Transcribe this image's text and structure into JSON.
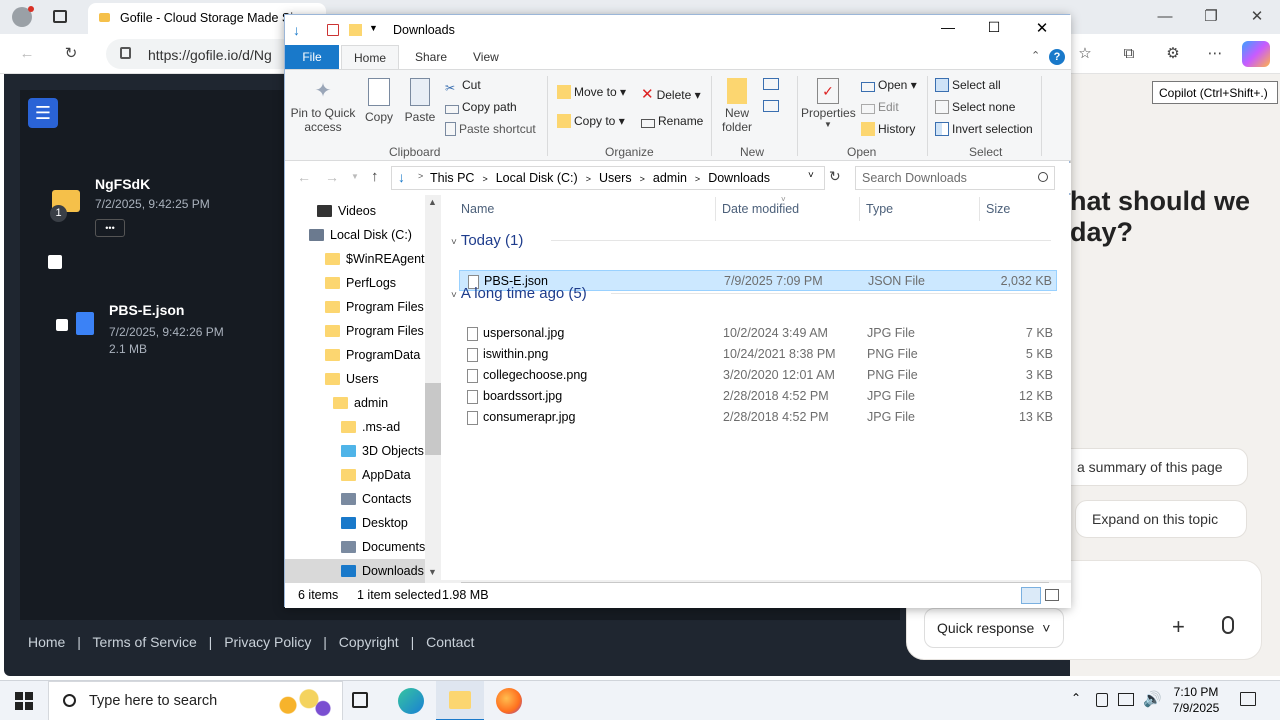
{
  "edge": {
    "tab_title": "Gofile - Cloud Storage Made Si",
    "address": "https://gofile.io/d/Ng",
    "tooltip": "Copilot (Ctrl+Shift+.)"
  },
  "gofile": {
    "folder_name": "NgFSdK",
    "folder_date": "7/2/2025, 9:42:25 PM",
    "folder_badge": "1",
    "more_label": "•••",
    "file_name": "PBS-E.json",
    "file_date": "7/2/2025, 9:42:26 PM",
    "file_size": "2.1 MB",
    "footer": [
      "Home",
      "Terms of Service",
      "Privacy Policy",
      "Copyright",
      "Contact"
    ]
  },
  "copilot": {
    "heading_line1": "hat should we",
    "heading_line2": "day?",
    "chip1": "a summary of this page",
    "chip2": "Expand on this topic",
    "quick": "Quick response"
  },
  "explorer": {
    "title": "Downloads",
    "tabs": [
      "File",
      "Home",
      "Share",
      "View"
    ],
    "clipboard": {
      "pin": [
        "Pin to Quick",
        "access"
      ],
      "copy": "Copy",
      "paste": "Paste",
      "cut": "Cut",
      "copy_path": "Copy path",
      "paste_shortcut": "Paste shortcut",
      "label": "Clipboard"
    },
    "organize": {
      "move_to": "Move to",
      "copy_to": "Copy to",
      "delete": "Delete",
      "rename": "Rename",
      "label": "Organize"
    },
    "new": {
      "new_folder": [
        "New",
        "folder"
      ],
      "label": "New"
    },
    "open": {
      "properties": "Properties",
      "open": "Open",
      "edit": "Edit",
      "history": "History",
      "label": "Open"
    },
    "select": {
      "select_all": "Select all",
      "select_none": "Select none",
      "invert": "Invert selection",
      "label": "Select"
    },
    "breadcrumb": [
      "This PC",
      "Local Disk (C:)",
      "Users",
      "admin",
      "Downloads"
    ],
    "search_placeholder": "Search Downloads",
    "tree": [
      {
        "label": "Videos",
        "indent": 1
      },
      {
        "label": "Local Disk (C:)",
        "indent": 0
      },
      {
        "label": "$WinREAgent",
        "indent": 2
      },
      {
        "label": "PerfLogs",
        "indent": 2
      },
      {
        "label": "Program Files",
        "indent": 2
      },
      {
        "label": "Program Files",
        "indent": 2
      },
      {
        "label": "ProgramData",
        "indent": 2
      },
      {
        "label": "Users",
        "indent": 2
      },
      {
        "label": "admin",
        "indent": 3
      },
      {
        "label": ".ms-ad",
        "indent": 4
      },
      {
        "label": "3D Objects",
        "indent": 4
      },
      {
        "label": "AppData",
        "indent": 4
      },
      {
        "label": "Contacts",
        "indent": 4
      },
      {
        "label": "Desktop",
        "indent": 4
      },
      {
        "label": "Documents",
        "indent": 4
      },
      {
        "label": "Downloads",
        "indent": 4
      }
    ],
    "columns": [
      "Name",
      "Date modified",
      "Type",
      "Size"
    ],
    "group_today": "Today (1)",
    "group_old": "A long time ago (5)",
    "today_files": [
      {
        "name": "PBS-E.json",
        "date": "7/9/2025 7:09 PM",
        "type": "JSON File",
        "size": "2,032 KB"
      }
    ],
    "old_files": [
      {
        "name": "uspersonal.jpg",
        "date": "10/2/2024 3:49 AM",
        "type": "JPG File",
        "size": "7 KB"
      },
      {
        "name": "iswithin.png",
        "date": "10/24/2021 8:38 PM",
        "type": "PNG File",
        "size": "5 KB"
      },
      {
        "name": "collegechoose.png",
        "date": "3/20/2020 12:01 AM",
        "type": "PNG File",
        "size": "3 KB"
      },
      {
        "name": "boardssort.jpg",
        "date": "2/28/2018 4:52 PM",
        "type": "JPG File",
        "size": "12 KB"
      },
      {
        "name": "consumerapr.jpg",
        "date": "2/28/2018 4:52 PM",
        "type": "JPG File",
        "size": "13 KB"
      }
    ],
    "status": {
      "items": "6 items",
      "selected": "1 item selected",
      "size": "1.98 MB"
    }
  },
  "taskbar": {
    "search_placeholder": "Type here to search",
    "time": "7:10 PM",
    "date": "7/9/2025"
  },
  "colors": {
    "accent": "#2a63d6",
    "selection": "#cce8ff",
    "gofile_bg": "#1f2630",
    "file_tab": "#1979ca"
  }
}
